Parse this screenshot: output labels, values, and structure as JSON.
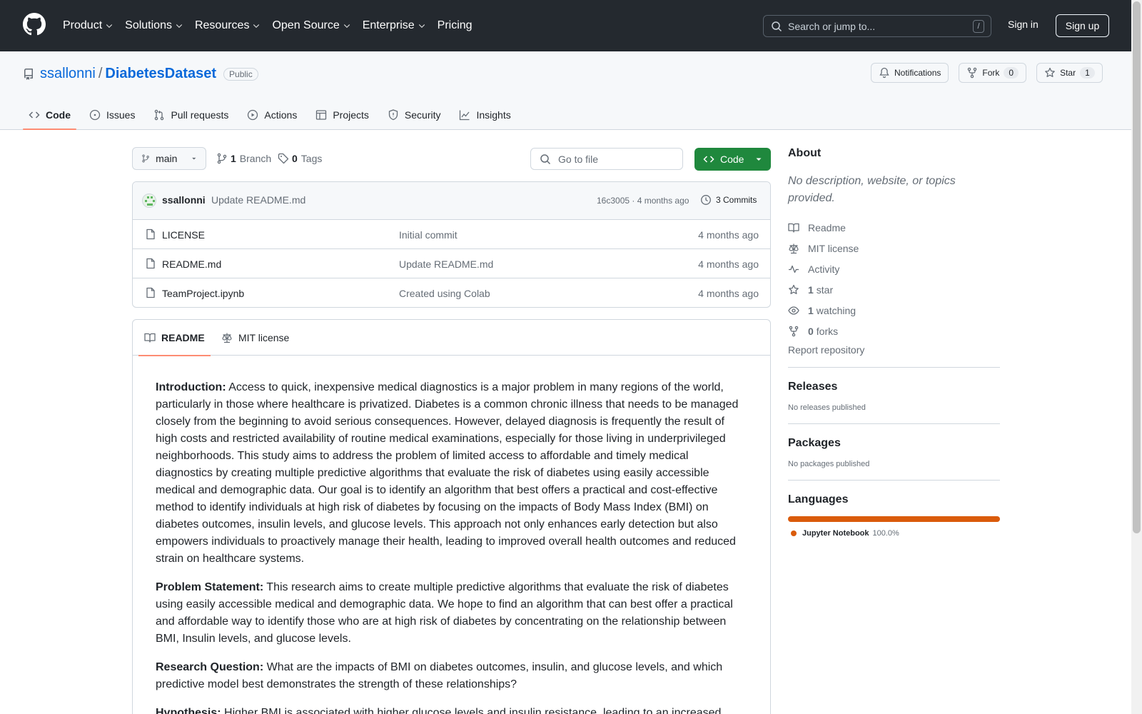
{
  "header": {
    "nav": [
      "Product",
      "Solutions",
      "Resources",
      "Open Source",
      "Enterprise",
      "Pricing"
    ],
    "search_placeholder": "Search or jump to...",
    "search_key": "/",
    "sign_in": "Sign in",
    "sign_up": "Sign up"
  },
  "repo": {
    "owner": "ssallonni",
    "separator": "/",
    "name": "DiabetesDataset",
    "visibility": "Public",
    "notifications": "Notifications",
    "fork": "Fork",
    "fork_count": "0",
    "star": "Star",
    "star_count": "1",
    "tabs": [
      "Code",
      "Issues",
      "Pull requests",
      "Actions",
      "Projects",
      "Security",
      "Insights"
    ]
  },
  "toolbar": {
    "branch": "main",
    "branch_count": "1",
    "branch_label": "Branch",
    "tag_count": "0",
    "tag_label": "Tags",
    "go_to_file": "Go to file",
    "code": "Code"
  },
  "commit": {
    "user": "ssallonni",
    "message": "Update README.md",
    "hash_age": "16c3005 · 4 months ago",
    "commits": "3 Commits"
  },
  "files": [
    {
      "name": "LICENSE",
      "message": "Initial commit",
      "age": "4 months ago"
    },
    {
      "name": "README.md",
      "message": "Update README.md",
      "age": "4 months ago"
    },
    {
      "name": "TeamProject.ipynb",
      "message": "Created using Colab",
      "age": "4 months ago"
    }
  ],
  "readme": {
    "tabs": [
      "README",
      "MIT license"
    ],
    "paragraphs": [
      {
        "label": "Introduction:",
        "text": " Access to quick, inexpensive medical diagnostics is a major problem in many regions of the world, particularly in those where healthcare is privatized. Diabetes is a common chronic illness that needs to be managed closely from the beginning to avoid serious consequences. However, delayed diagnosis is frequently the result of high costs and restricted availability of routine medical examinations, especially for those living in underprivileged neighborhoods. This study aims to address the problem of limited access to affordable and timely medical diagnostics by creating multiple predictive algorithms that evaluate the risk of diabetes using easily accessible medical and demographic data. Our goal is to identify an algorithm that best offers a practical and cost-effective method to identify individuals at high risk of diabetes by focusing on the impacts of Body Mass Index (BMI) on diabetes outcomes, insulin levels, and glucose levels. This approach not only enhances early detection but also empowers individuals to proactively manage their health, leading to improved overall health outcomes and reduced strain on healthcare systems."
      },
      {
        "label": "Problem Statement:",
        "text": " This research aims to create multiple predictive algorithms that evaluate the risk of diabetes using easily accessible medical and demographic data. We hope to find an algorithm that can best offer a practical and affordable way to identify those who are at high risk of diabetes by concentrating on the relationship between BMI, Insulin levels, and glucose levels."
      },
      {
        "label": "Research Question:",
        "text": " What are the impacts of BMI on diabetes outcomes, insulin, and glucose levels, and which predictive model best demonstrates the strength of these relationships?"
      },
      {
        "label": "Hypothesis:",
        "text": " Higher BMI is associated with higher glucose levels and insulin resistance, leading to an increased"
      }
    ]
  },
  "about": {
    "title": "About",
    "description": "No description, website, or topics provided.",
    "links": [
      {
        "count": "",
        "label": "Readme",
        "icon": "book-icon"
      },
      {
        "count": "",
        "label": "MIT license",
        "icon": "law-icon"
      },
      {
        "count": "",
        "label": "Activity",
        "icon": "pulse-icon"
      },
      {
        "count": "1",
        "label": "star",
        "icon": "star-icon"
      },
      {
        "count": "1",
        "label": "watching",
        "icon": "eye-icon"
      },
      {
        "count": "0",
        "label": "forks",
        "icon": "fork-icon"
      }
    ],
    "report": "Report repository",
    "releases_title": "Releases",
    "releases_text": "No releases published",
    "packages_title": "Packages",
    "packages_text": "No packages published",
    "languages_title": "Languages",
    "language": {
      "name": "Jupyter Notebook",
      "percent": "100.0%",
      "color": "#da5b0b"
    }
  }
}
